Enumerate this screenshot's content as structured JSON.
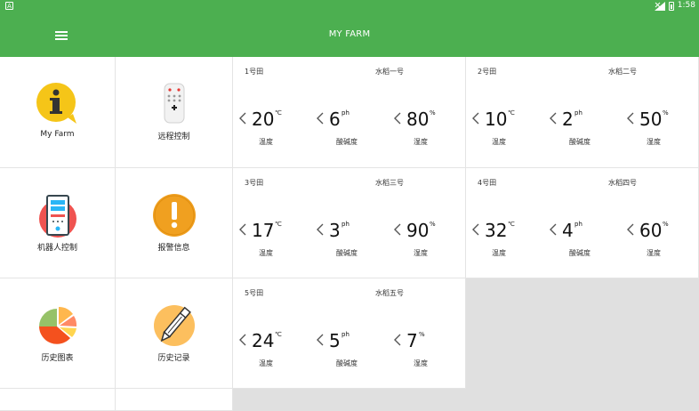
{
  "statusbar": {
    "left_icon": "A",
    "time": "1:58"
  },
  "toolbar": {
    "title": "MY FARM"
  },
  "tiles": [
    {
      "label": "My Farm",
      "icon": "info-icon"
    },
    {
      "label": "远程控制",
      "icon": "remote-control-icon"
    },
    {
      "label": "机器人控制",
      "icon": "robot-icon"
    },
    {
      "label": "报警信息",
      "icon": "alert-icon"
    },
    {
      "label": "历史图表",
      "icon": "pie-chart-icon"
    },
    {
      "label": "历史记录",
      "icon": "pen-icon"
    }
  ],
  "fields": [
    {
      "name": "1号田",
      "crop": "水稻一号",
      "temp": {
        "value": "20",
        "unit": "℃",
        "label": "温度"
      },
      "ph": {
        "value": "6",
        "unit": "ph",
        "label": "酸碱度"
      },
      "humidity": {
        "value": "80",
        "unit": "%",
        "label": "湿度"
      }
    },
    {
      "name": "2号田",
      "crop": "水稻二号",
      "temp": {
        "value": "10",
        "unit": "℃",
        "label": "温度"
      },
      "ph": {
        "value": "2",
        "unit": "ph",
        "label": "酸碱度"
      },
      "humidity": {
        "value": "50",
        "unit": "%",
        "label": "湿度"
      }
    },
    {
      "name": "3号田",
      "crop": "水稻三号",
      "temp": {
        "value": "17",
        "unit": "℃",
        "label": "温度"
      },
      "ph": {
        "value": "3",
        "unit": "ph",
        "label": "酸碱度"
      },
      "humidity": {
        "value": "90",
        "unit": "%",
        "label": "湿度"
      }
    },
    {
      "name": "4号田",
      "crop": "水稻四号",
      "temp": {
        "value": "32",
        "unit": "℃",
        "label": "温度"
      },
      "ph": {
        "value": "4",
        "unit": "ph",
        "label": "酸碱度"
      },
      "humidity": {
        "value": "60",
        "unit": "%",
        "label": "湿度"
      }
    },
    {
      "name": "5号田",
      "crop": "水稻五号",
      "temp": {
        "value": "24",
        "unit": "℃",
        "label": "温度"
      },
      "ph": {
        "value": "5",
        "unit": "ph",
        "label": "酸碱度"
      },
      "humidity": {
        "value": "7",
        "unit": "%",
        "label": "湿度"
      }
    }
  ],
  "colors": {
    "primary": "#4caf50",
    "info_yellow": "#f5c518",
    "alert_orange": "#f0a020",
    "pie_red": "#f4511e",
    "pen_peach": "#fcbf5e"
  }
}
